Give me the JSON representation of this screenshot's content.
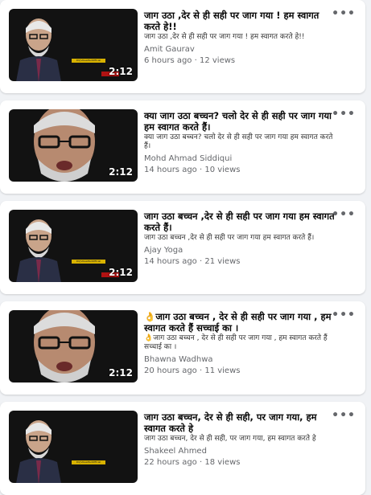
{
  "videos": [
    {
      "title": "जाग उठा ,देर से ही सही पर जाग गया ! हम स्वागत करते हे!!",
      "description": "जाग उठा ,देर से ही सही पर जाग गया ! हम स्वागत करते हे!!",
      "author": "Amit Gaurav",
      "meta": "6 hours ago · 12 views",
      "duration": "2:12",
      "subtitle_chip": "DU|VibesMedOfficial"
    },
    {
      "title": "क्या जाग उठा बच्चन? चलो देर से ही सही पर जाग गया हम स्वागत करते हैं।",
      "description": "क्या जाग उठा बच्चन? चलो देर से ही सही पर जाग गया हम स्वागत करते हैं।",
      "author": "Mohd Ahmad Siddiqui",
      "meta": "14 hours ago · 10 views",
      "duration": "2:12",
      "subtitle_chip": ""
    },
    {
      "title": "जाग उठा बच्चन ,देर से ही सही पर जाग गया हम स्वागत करते हैं।",
      "description": "जाग उठा बच्चन ,देर से ही सही पर जाग गया हम स्वागत करते हैं।",
      "author": "Ajay Yoga",
      "meta": "14 hours ago · 21 views",
      "duration": "2:12",
      "subtitle_chip": "DU|VibesMedOfficial"
    },
    {
      "title": "👌जाग उठा बच्चन , देर से ही सही पर जाग गया , हम स्वागत करते हैं सच्चाई का ।",
      "description": "👌जाग उठा बच्चन , देर से ही सही पर जाग गया , हम स्वागत करते हैं सच्चाई का ।",
      "author": "Bhawna Wadhwa",
      "meta": "20 hours ago · 11 views",
      "duration": "2:12",
      "subtitle_chip": ""
    },
    {
      "title": "जाग उठा बच्चन, देर से ही सही, पर जाग गया, हम स्वागत करते हे",
      "description": "जाग उठा बच्चन, देर से ही सही, पर जाग गया, हम स्वागत करते हे",
      "author": "Shakeel Ahmed",
      "meta": "22 hours ago · 18 views",
      "duration": "",
      "subtitle_chip": "DU|VibesMedOfficial"
    }
  ],
  "more_icon": "more-horizontal-icon",
  "colors": {
    "background": "#f0f2f5",
    "card": "#ffffff",
    "title": "#050505",
    "secondary": "#65676b"
  }
}
